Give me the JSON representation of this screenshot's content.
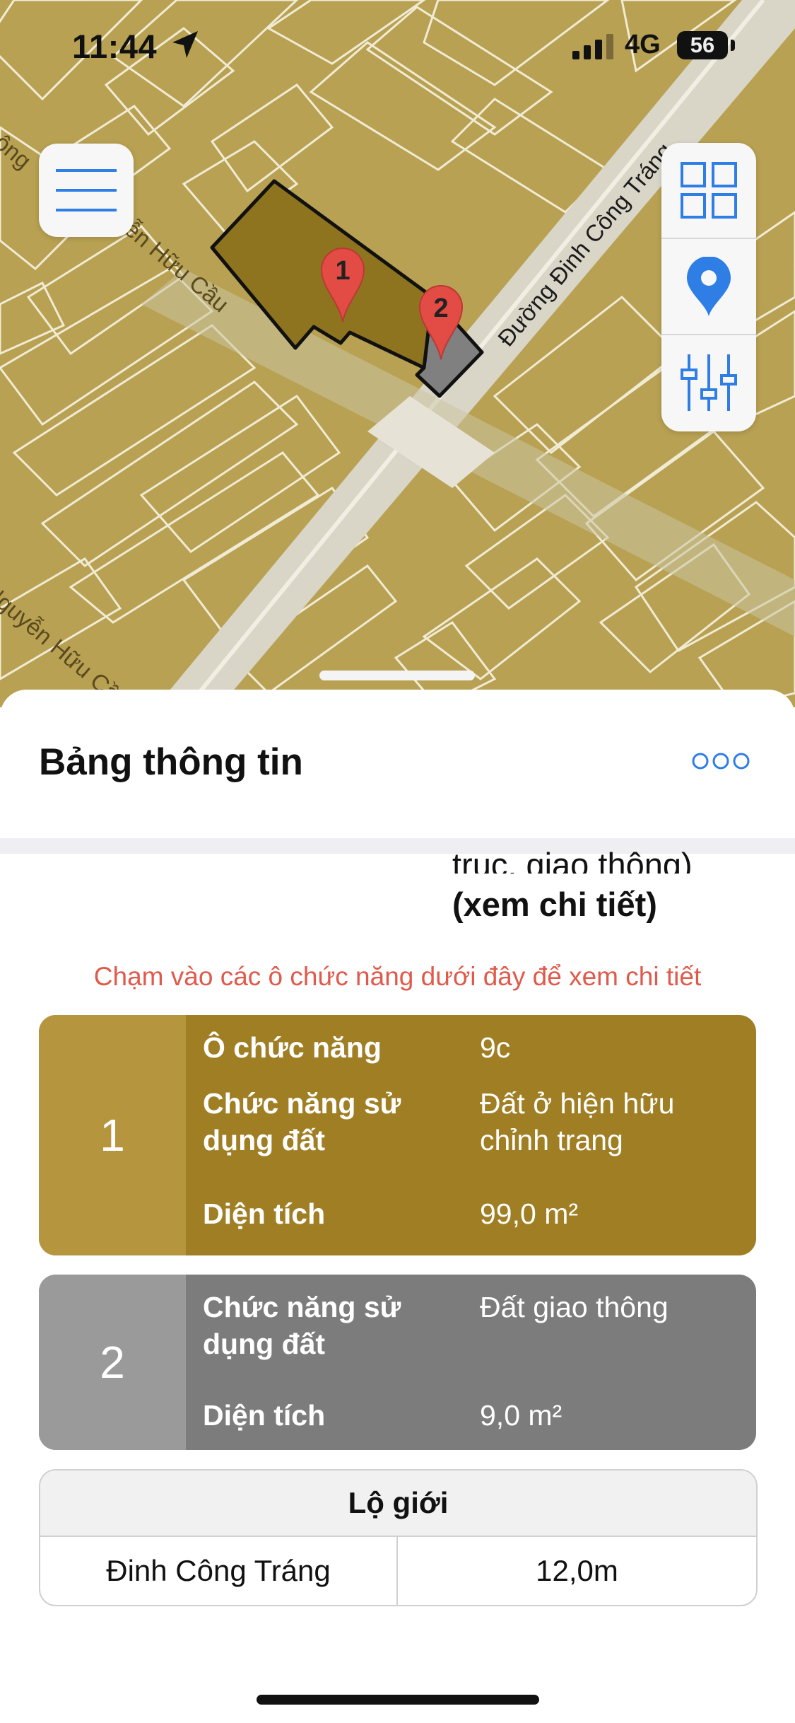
{
  "status_bar": {
    "time": "11:44",
    "network": "4G",
    "battery": "56"
  },
  "map": {
    "street_labels": [
      "Đường Đinh Công Tráng",
      "Nguyễn Hữu Cầu",
      "ông",
      "Nguyễn Hữu Cầu"
    ],
    "markers": [
      {
        "label": "1"
      },
      {
        "label": "2"
      }
    ],
    "controls": [
      "menu-icon",
      "layers-grid-icon",
      "location-pin-icon",
      "sliders-icon"
    ],
    "colors": {
      "land": "#b8a152",
      "parcel_1": "#8f7420",
      "parcel_2": "#808080",
      "road": "#d8d4c4"
    }
  },
  "sheet": {
    "title": "Bảng thông tin",
    "prev_text_clipped": "trục, giao thông)",
    "prev_text_link": "(xem chi tiết)",
    "hint": "Chạm vào các ô chức năng dưới đây để xem chi tiết",
    "parcels": [
      {
        "number": "1",
        "rows": [
          {
            "label": "Ô chức năng",
            "value": "9c"
          },
          {
            "label": "Chức năng sử dụng đất",
            "value": "Đất ở hiện hữu chỉnh trang"
          },
          {
            "label": "Diện tích",
            "value": "99,0 m²"
          }
        ]
      },
      {
        "number": "2",
        "rows": [
          {
            "label": "Chức năng sử dụng đất",
            "value": "Đất giao thông"
          },
          {
            "label": "Diện tích",
            "value": "9,0 m²"
          }
        ]
      }
    ],
    "road_table": {
      "header": "Lộ giới",
      "street": "Đinh Công Tráng",
      "width": "12,0m"
    }
  }
}
